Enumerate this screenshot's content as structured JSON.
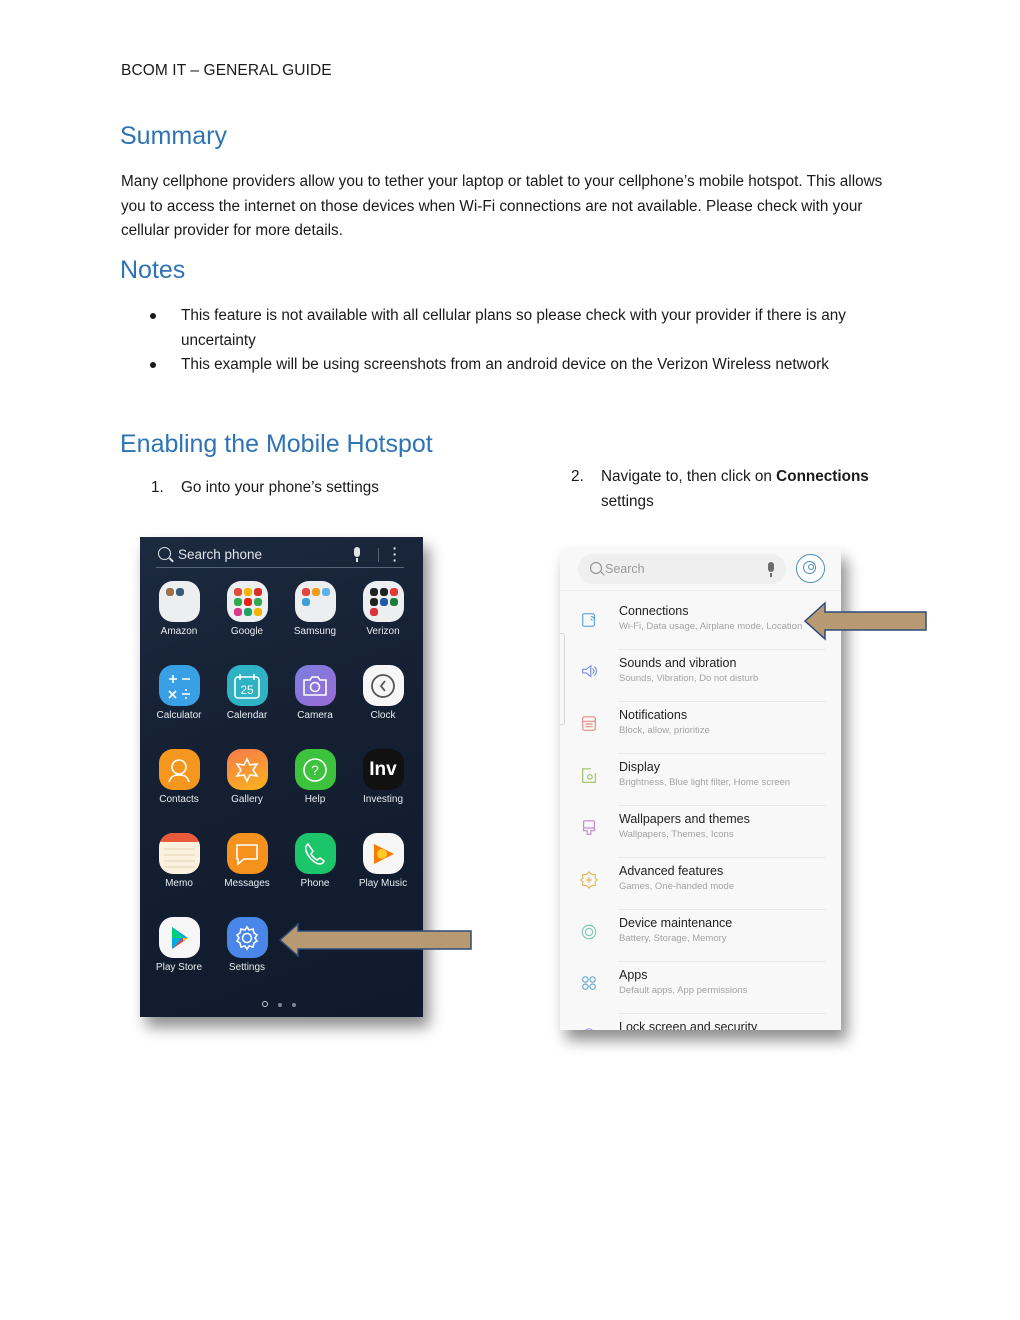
{
  "document": {
    "header": "BCOM IT – GENERAL GUIDE",
    "sections": {
      "summary": {
        "heading": "Summary",
        "body": "Many cellphone providers allow you to tether your laptop or tablet to your cellphone’s mobile hotspot. This allows you to access the internet on those devices when Wi-Fi connections are not available. Please check with your cellular provider for more details."
      },
      "notes": {
        "heading": "Notes",
        "items": [
          "This feature is not available with all cellular plans so please check with your provider if there is any uncertainty",
          "This example will be using screenshots from an android device on the Verizon Wireless network"
        ]
      },
      "enabling": {
        "heading": "Enabling the Mobile Hotspot",
        "steps": [
          {
            "number": "1.",
            "text": "Go into your phone’s settings"
          },
          {
            "number": "2.",
            "text_before": "Navigate to, then click on ",
            "bold": "Connections",
            "text_after": " settings"
          }
        ]
      }
    }
  },
  "screenshot1": {
    "search_placeholder": "Search phone",
    "apps": [
      {
        "label": "Amazon",
        "icon": "folder-icon"
      },
      {
        "label": "Google",
        "icon": "folder-icon"
      },
      {
        "label": "Samsung",
        "icon": "folder-icon"
      },
      {
        "label": "Verizon",
        "icon": "folder-icon"
      },
      {
        "label": "Calculator",
        "icon": "calculator-icon"
      },
      {
        "label": "Calendar",
        "icon": "calendar-icon",
        "badge": "25"
      },
      {
        "label": "Camera",
        "icon": "camera-icon"
      },
      {
        "label": "Clock",
        "icon": "clock-icon"
      },
      {
        "label": "Contacts",
        "icon": "contacts-icon"
      },
      {
        "label": "Gallery",
        "icon": "gallery-icon"
      },
      {
        "label": "Help",
        "icon": "help-icon",
        "glyph": "?"
      },
      {
        "label": "Investing",
        "icon": "investing-icon",
        "glyph": "Inv"
      },
      {
        "label": "Memo",
        "icon": "memo-icon"
      },
      {
        "label": "Messages",
        "icon": "messages-icon"
      },
      {
        "label": "Phone",
        "icon": "phone-icon"
      },
      {
        "label": "Play Music",
        "icon": "play-music-icon"
      },
      {
        "label": "Play Store",
        "icon": "play-store-icon"
      },
      {
        "label": "Settings",
        "icon": "settings-icon"
      }
    ],
    "page_count": 3,
    "active_page": 1
  },
  "screenshot2": {
    "search_placeholder": "Search",
    "items": [
      {
        "title": "Connections",
        "subtitle": "Wi-Fi, Data usage, Airplane mode, Location",
        "icon": "connections-icon",
        "color": "#5aa6d6"
      },
      {
        "title": "Sounds and vibration",
        "subtitle": "Sounds, Vibration, Do not disturb",
        "icon": "sound-icon",
        "color": "#7d8fd6"
      },
      {
        "title": "Notifications",
        "subtitle": "Block, allow, prioritize",
        "icon": "notifications-icon",
        "color": "#e58a84"
      },
      {
        "title": "Display",
        "subtitle": "Brightness, Blue light filter, Home screen",
        "icon": "display-icon",
        "color": "#9bbf6a"
      },
      {
        "title": "Wallpapers and themes",
        "subtitle": "Wallpapers, Themes, Icons",
        "icon": "wallpaper-icon",
        "color": "#c08bd0"
      },
      {
        "title": "Advanced features",
        "subtitle": "Games, One-handed mode",
        "icon": "advanced-features-icon",
        "color": "#e6b95a"
      },
      {
        "title": "Device maintenance",
        "subtitle": "Battery, Storage, Memory",
        "icon": "device-maintenance-icon",
        "color": "#7fc8b6"
      },
      {
        "title": "Apps",
        "subtitle": "Default apps, App permissions",
        "icon": "apps-icon",
        "color": "#6aaed6"
      },
      {
        "title": "Lock screen and security",
        "subtitle": "",
        "icon": "lock-icon",
        "color": "#a99be0"
      }
    ]
  },
  "colors": {
    "heading": "#2e74b5",
    "arrow_fill": "#b89a72",
    "arrow_stroke": "#2f4a7a"
  }
}
